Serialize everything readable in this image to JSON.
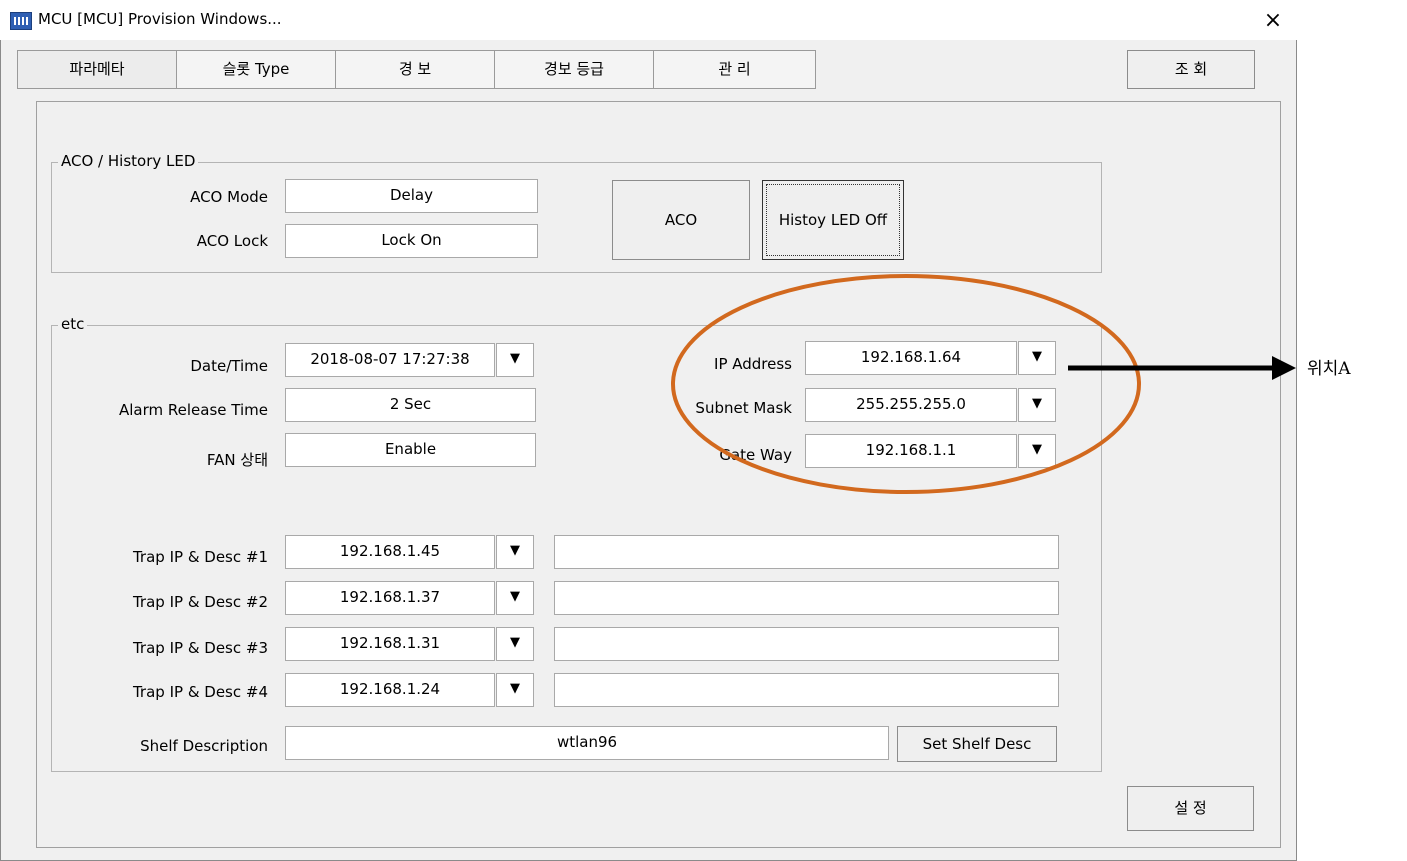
{
  "window": {
    "title": "MCU [MCU] Provision Windows...",
    "close_glyph": "×",
    "icon": "app-icon"
  },
  "tabs": [
    {
      "label": "파라메타",
      "active": true
    },
    {
      "label": "슬롯 Type"
    },
    {
      "label": "경 보"
    },
    {
      "label": "경보 등급"
    },
    {
      "label": "관 리"
    }
  ],
  "query_button": "조 회",
  "aco_group": {
    "title": "ACO / History LED",
    "aco_mode_label": "ACO Mode",
    "aco_mode_value": "Delay",
    "aco_lock_label": "ACO Lock",
    "aco_lock_value": "Lock On",
    "aco_button": "ACO",
    "history_button": "Histoy LED Off"
  },
  "etc_group": {
    "title": "etc",
    "date_label": "Date/Time",
    "date_value": "2018-08-07 17:27:38",
    "alarm_label": "Alarm Release Time",
    "alarm_value": "2 Sec",
    "fan_label": "FAN 상태",
    "fan_value": "Enable",
    "ip_label": "IP Address",
    "ip_value": "192.168.1.64",
    "subnet_label": "Subnet Mask",
    "subnet_value": "255.255.255.0",
    "gateway_label": "Gate Way",
    "gateway_value": "192.168.1.1",
    "dropdown_glyph": "▼",
    "trap": [
      {
        "label": "Trap IP & Desc #1",
        "ip": "192.168.1.45",
        "desc": ""
      },
      {
        "label": "Trap IP & Desc #2",
        "ip": "192.168.1.37",
        "desc": ""
      },
      {
        "label": "Trap IP & Desc #3",
        "ip": "192.168.1.31",
        "desc": ""
      },
      {
        "label": "Trap IP & Desc #4",
        "ip": "192.168.1.24",
        "desc": ""
      }
    ],
    "shelf_label": "Shelf Description",
    "shelf_value": "wtlan96",
    "shelf_button": "Set Shelf Desc"
  },
  "set_button": "설 정",
  "annotation": {
    "label": "위치A",
    "color": "#d2691e"
  }
}
